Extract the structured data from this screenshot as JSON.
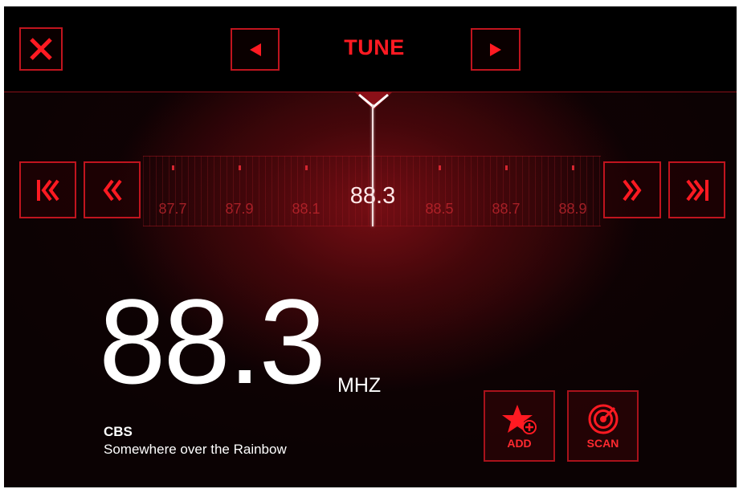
{
  "header": {
    "title": "TUNE"
  },
  "icons": {
    "close": "close-icon",
    "prev": "arrow-left-icon",
    "next": "arrow-right-icon",
    "skip_first": "skip-to-start-icon",
    "seek_back": "double-chevron-left-icon",
    "seek_forward": "double-chevron-right-icon",
    "skip_last": "skip-to-end-icon",
    "add": "star-plus-icon",
    "scan": "radar-icon"
  },
  "dial": {
    "frequencies": [
      "87.7",
      "87.9",
      "88.1",
      "88.3",
      "88.5",
      "88.7",
      "88.9"
    ],
    "selected": "88.3"
  },
  "station": {
    "frequency": "88.3",
    "unit": "MHZ",
    "name": "CBS",
    "song": "Somewhere over the Rainbow"
  },
  "actions": {
    "add_label": "ADD",
    "scan_label": "SCAN"
  },
  "colors": {
    "accent": "#ff1a22",
    "border": "#c0141e",
    "background": "#0b0203"
  }
}
